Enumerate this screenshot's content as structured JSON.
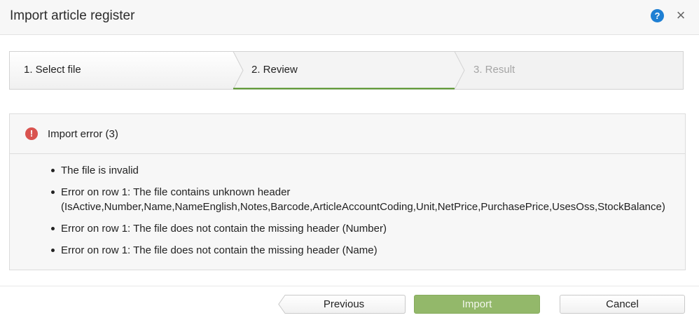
{
  "dialog": {
    "title": "Import article register"
  },
  "header_icons": {
    "help": "question-mark-icon",
    "close": "close-icon",
    "help_glyph": "?",
    "close_glyph": "×"
  },
  "wizard": {
    "steps": [
      {
        "label": "1. Select file",
        "state": "completed"
      },
      {
        "label": "2. Review",
        "state": "active"
      },
      {
        "label": "3. Result",
        "state": "disabled"
      }
    ],
    "active_color": "#4e8f1f"
  },
  "errors": {
    "title": "Import error (3)",
    "icon_glyph": "!",
    "icon_color": "#d9534f",
    "items": [
      "The file is invalid",
      "Error on row 1: The file contains unknown header (IsActive,Number,Name,NameEnglish,Notes,Barcode,ArticleAccountCoding,Unit,NetPrice,PurchasePrice,UsesOss,StockBalance)",
      "Error on row 1: The file does not contain the missing header (Number)",
      "Error on row 1: The file does not contain the missing header (Name)"
    ]
  },
  "footer": {
    "previous_label": "Previous",
    "import_label": "Import",
    "cancel_label": "Cancel",
    "import_color": "#93b86a"
  }
}
